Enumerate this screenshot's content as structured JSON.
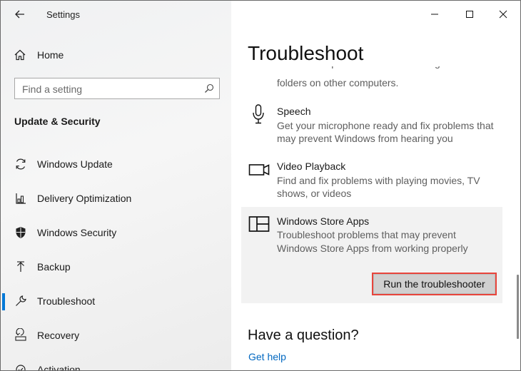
{
  "window": {
    "title": "Settings"
  },
  "sidebar": {
    "home_label": "Home",
    "search_placeholder": "Find a setting",
    "section_title": "Update & Security",
    "items": [
      {
        "label": "Windows Update",
        "icon": "sync-icon"
      },
      {
        "label": "Delivery Optimization",
        "icon": "delivery-optimization-icon"
      },
      {
        "label": "Windows Security",
        "icon": "shield-icon"
      },
      {
        "label": "Backup",
        "icon": "backup-arrow-icon"
      },
      {
        "label": "Troubleshoot",
        "icon": "wrench-icon",
        "active": true
      },
      {
        "label": "Recovery",
        "icon": "recovery-icon"
      },
      {
        "label": "Activation",
        "icon": "activation-icon"
      }
    ]
  },
  "main": {
    "title": "Troubleshoot",
    "items": [
      {
        "title": "",
        "description_line1": "Find and fix problems with accessing files and",
        "description_line2": "folders on other computers."
      },
      {
        "title": "Speech",
        "description_line1": "Get your microphone ready and fix problems that",
        "description_line2": "may prevent Windows from hearing you",
        "icon": "microphone-icon"
      },
      {
        "title": "Video Playback",
        "description_line1": "Find and fix problems with playing movies, TV",
        "description_line2": "shows, or videos",
        "icon": "video-camera-icon"
      },
      {
        "title": "Windows Store Apps",
        "description_line1": "Troubleshoot problems that may prevent",
        "description_line2": "Windows Store Apps from working properly",
        "icon": "store-apps-icon",
        "selected": true
      }
    ],
    "run_button_label": "Run the troubleshooter",
    "question_heading": "Have a question?",
    "get_help_link": "Get help"
  },
  "colors": {
    "accent": "#0078d7",
    "link": "#0067c0",
    "highlight_border": "#e8453c",
    "selected_item_bg": "#f2f2f2"
  }
}
